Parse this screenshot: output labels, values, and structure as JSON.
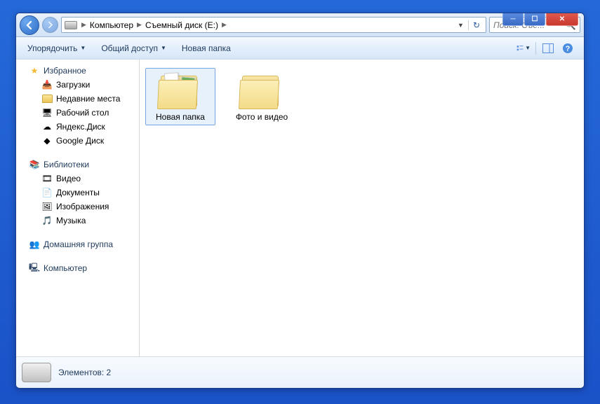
{
  "window": {
    "title": "Съемный диск (E:)"
  },
  "breadcrumbs": {
    "item0": "Компьютер",
    "item1": "Съемный диск (E:)"
  },
  "search": {
    "placeholder": "Поиск: Съе..."
  },
  "toolbar": {
    "organize": "Упорядочить",
    "share": "Общий доступ",
    "new_folder": "Новая папка"
  },
  "sidebar": {
    "favorites": {
      "header": "Избранное",
      "items": {
        "downloads": "Загрузки",
        "recent": "Недавние места",
        "desktop": "Рабочий стол",
        "yandex": "Яндекс.Диск",
        "google": "Google Диск"
      }
    },
    "libraries": {
      "header": "Библиотеки",
      "items": {
        "video": "Видео",
        "documents": "Документы",
        "images": "Изображения",
        "music": "Музыка"
      }
    },
    "homegroup": {
      "header": "Домашняя группа"
    },
    "computer": {
      "header": "Компьютер"
    }
  },
  "files": {
    "item0": "Новая папка",
    "item1": "Фото и видео"
  },
  "statusbar": {
    "count_label": "Элементов: 2"
  }
}
